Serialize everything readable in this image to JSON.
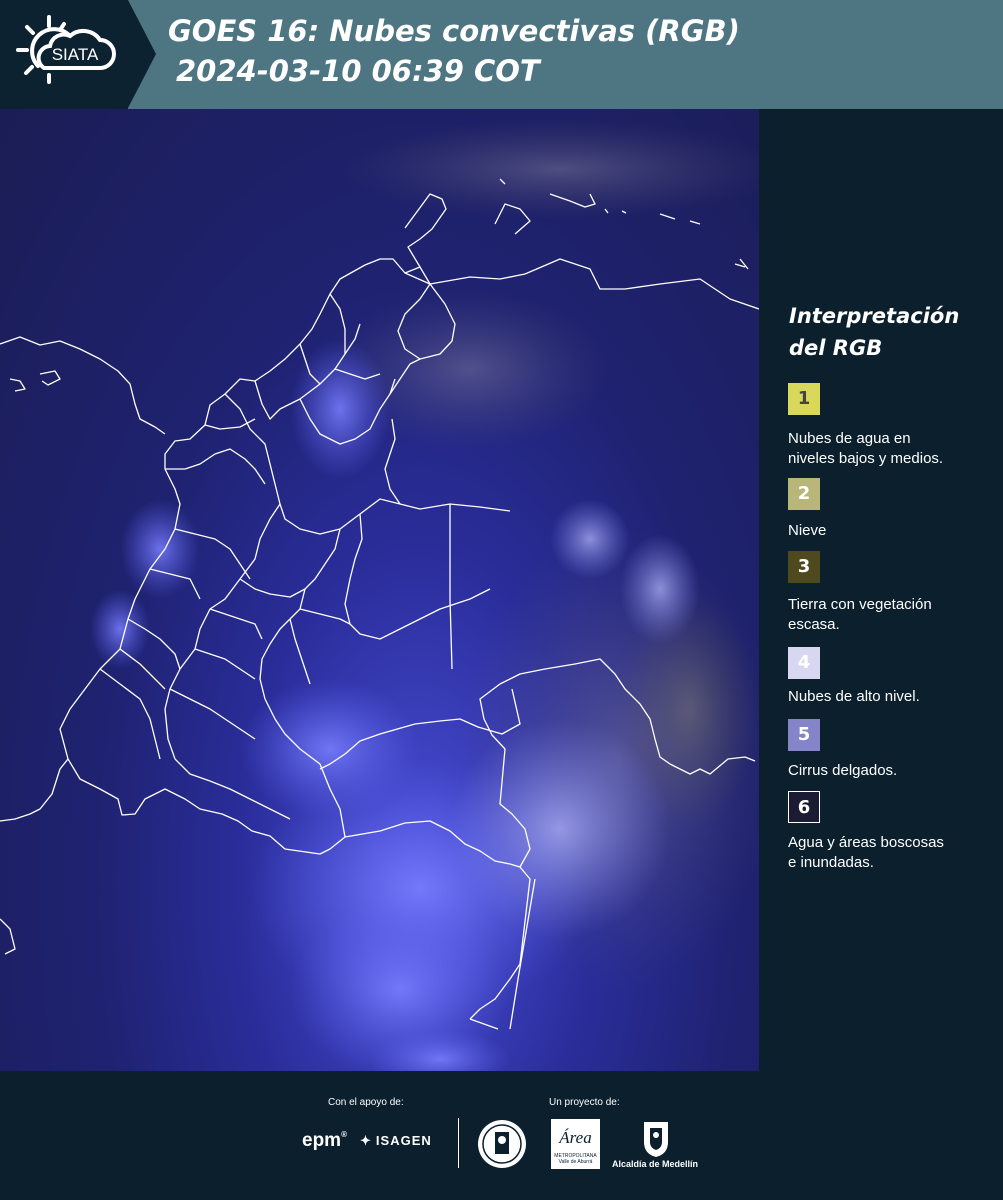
{
  "header": {
    "logo_text": "SIATA",
    "title_line1": "GOES 16: Nubes convectivas (RGB)",
    "title_line2": "2024-03-10 06:39 COT"
  },
  "legend": {
    "title_line1": "Interpretación",
    "title_line2": "del RGB",
    "items": [
      {
        "number": "1",
        "label_line1": "Nubes de agua en",
        "label_line2": "niveles bajos y medios.",
        "color": "#d9d85a",
        "text_color": "#444444"
      },
      {
        "number": "2",
        "label_line1": "Nieve",
        "label_line2": "",
        "color": "#b9b67a",
        "text_color": "#ffffff"
      },
      {
        "number": "3",
        "label_line1": "Tierra con vegetación",
        "label_line2": "escasa.",
        "color": "#4f4a1d",
        "text_color": "#ffffff"
      },
      {
        "number": "4",
        "label_line1": "Nubes de alto nivel.",
        "label_line2": "",
        "color": "#d7d7f2",
        "text_color": "#ffffff"
      },
      {
        "number": "5",
        "label_line1": "Cirrus delgados.",
        "label_line2": "",
        "color": "#8584c9",
        "text_color": "#ffffff"
      },
      {
        "number": "6",
        "label_line1": "Agua y áreas boscosas",
        "label_line2": "e inundadas.",
        "color": "#1b1c33",
        "text_color": "#ffffff"
      }
    ]
  },
  "footer": {
    "support_label": "Con el apoyo de:",
    "project_label": "Un proyecto de:",
    "epm": "epm",
    "isagen": "ISAGEN",
    "area_title": "Área",
    "area_sub1": "METROPOLITANA",
    "area_sub2": "Valle de Aburrá",
    "alcaldia": "Alcaldía de Medellín"
  },
  "colors": {
    "header_bg": "#4e7582",
    "logo_bg": "#0d2230",
    "page_bg": "#0b1f2c",
    "map_base": "#1f2270",
    "cloud_high": "#5a5ff0",
    "border_lines": "#ffffff"
  }
}
